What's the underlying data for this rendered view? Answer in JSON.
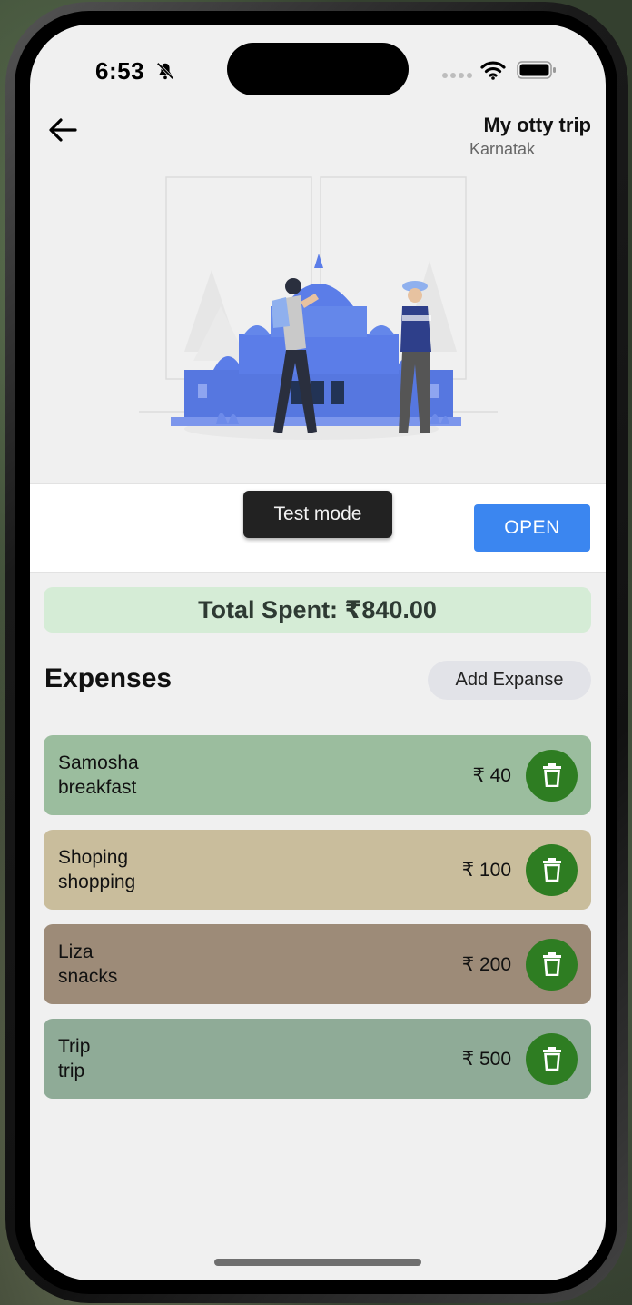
{
  "status_bar": {
    "time": "6:53",
    "icons": [
      "bell-slash-icon",
      "signal-icon",
      "wifi-icon",
      "battery-icon"
    ]
  },
  "header": {
    "back_icon": "arrow-left-icon",
    "title": "My otty trip",
    "subtitle": "Karnatak"
  },
  "ad": {
    "badge": "Test mode",
    "open_label": "OPEN",
    "open_color": "#3b86f0"
  },
  "summary": {
    "total_text": "Total Spent: ₹840.00",
    "background": "#d5ecd6"
  },
  "expenses": {
    "heading": "Expenses",
    "add_label": "Add Expanse",
    "items": [
      {
        "name": "Samosha",
        "category": "breakfast",
        "amount": "₹ 40",
        "color": "#9bbd9e"
      },
      {
        "name": "Shoping",
        "category": "shopping",
        "amount": "₹ 100",
        "color": "#c9bd9c"
      },
      {
        "name": "Liza",
        "category": "snacks",
        "amount": "₹ 200",
        "color": "#9d8b78"
      },
      {
        "name": "Trip",
        "category": "trip",
        "amount": "₹ 500",
        "color": "#8fab97"
      }
    ],
    "delete_icon": "trash-icon",
    "delete_color": "#2e7d22"
  }
}
